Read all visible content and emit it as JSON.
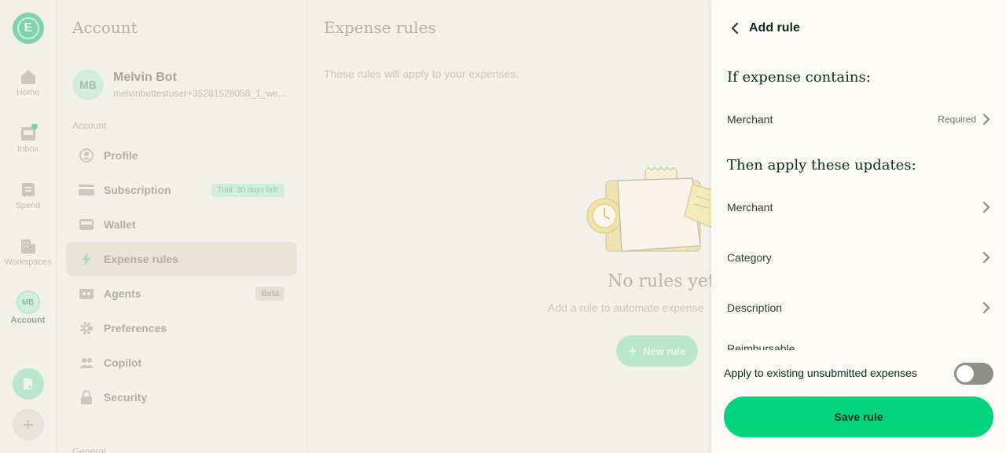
{
  "rail": {
    "logo_letter": "E",
    "items": [
      {
        "label": "Home",
        "icon": "home-icon"
      },
      {
        "label": "Inbox",
        "icon": "inbox-icon"
      },
      {
        "label": "Spend",
        "icon": "receipt-icon"
      },
      {
        "label": "Workspaces",
        "icon": "building-icon"
      },
      {
        "label": "Account",
        "icon": "avatar"
      }
    ],
    "avatar_initials": "MB"
  },
  "account": {
    "title": "Account",
    "user": {
      "initials": "MB",
      "name": "Melvin Bot",
      "email": "melvinbottestuser+35281528058_1_we..."
    },
    "section_account": "Account",
    "section_general": "General",
    "menu": [
      {
        "label": "Profile",
        "icon": "user-circle-icon"
      },
      {
        "label": "Subscription",
        "icon": "credit-card-icon",
        "badge": "Trial: 30 days left!"
      },
      {
        "label": "Wallet",
        "icon": "wallet-icon"
      },
      {
        "label": "Expense rules",
        "icon": "lightning-icon"
      },
      {
        "label": "Agents",
        "icon": "robot-icon",
        "badge": "Beta"
      },
      {
        "label": "Preferences",
        "icon": "gear-icon"
      },
      {
        "label": "Copilot",
        "icon": "users-icon"
      },
      {
        "label": "Security",
        "icon": "lock-icon"
      }
    ]
  },
  "main": {
    "title": "Expense rules",
    "subtitle": "These rules will apply to your expenses.",
    "empty_title": "No rules yet",
    "empty_subtitle": "Add a rule to automate expense",
    "new_rule": "New rule"
  },
  "panel": {
    "title": "Add rule",
    "if_heading": "If expense contains:",
    "condition": {
      "label": "Merchant",
      "status": "Required"
    },
    "then_heading": "Then apply these updates:",
    "updates": [
      "Merchant",
      "Category",
      "Description"
    ],
    "clipped_item": "Reimbursable",
    "toggle_label": "Apply to existing unsubmitted expenses",
    "toggle_on": false,
    "save": "Save rule"
  },
  "colors": {
    "accent": "#03d47c",
    "text": "#0b2d22"
  }
}
